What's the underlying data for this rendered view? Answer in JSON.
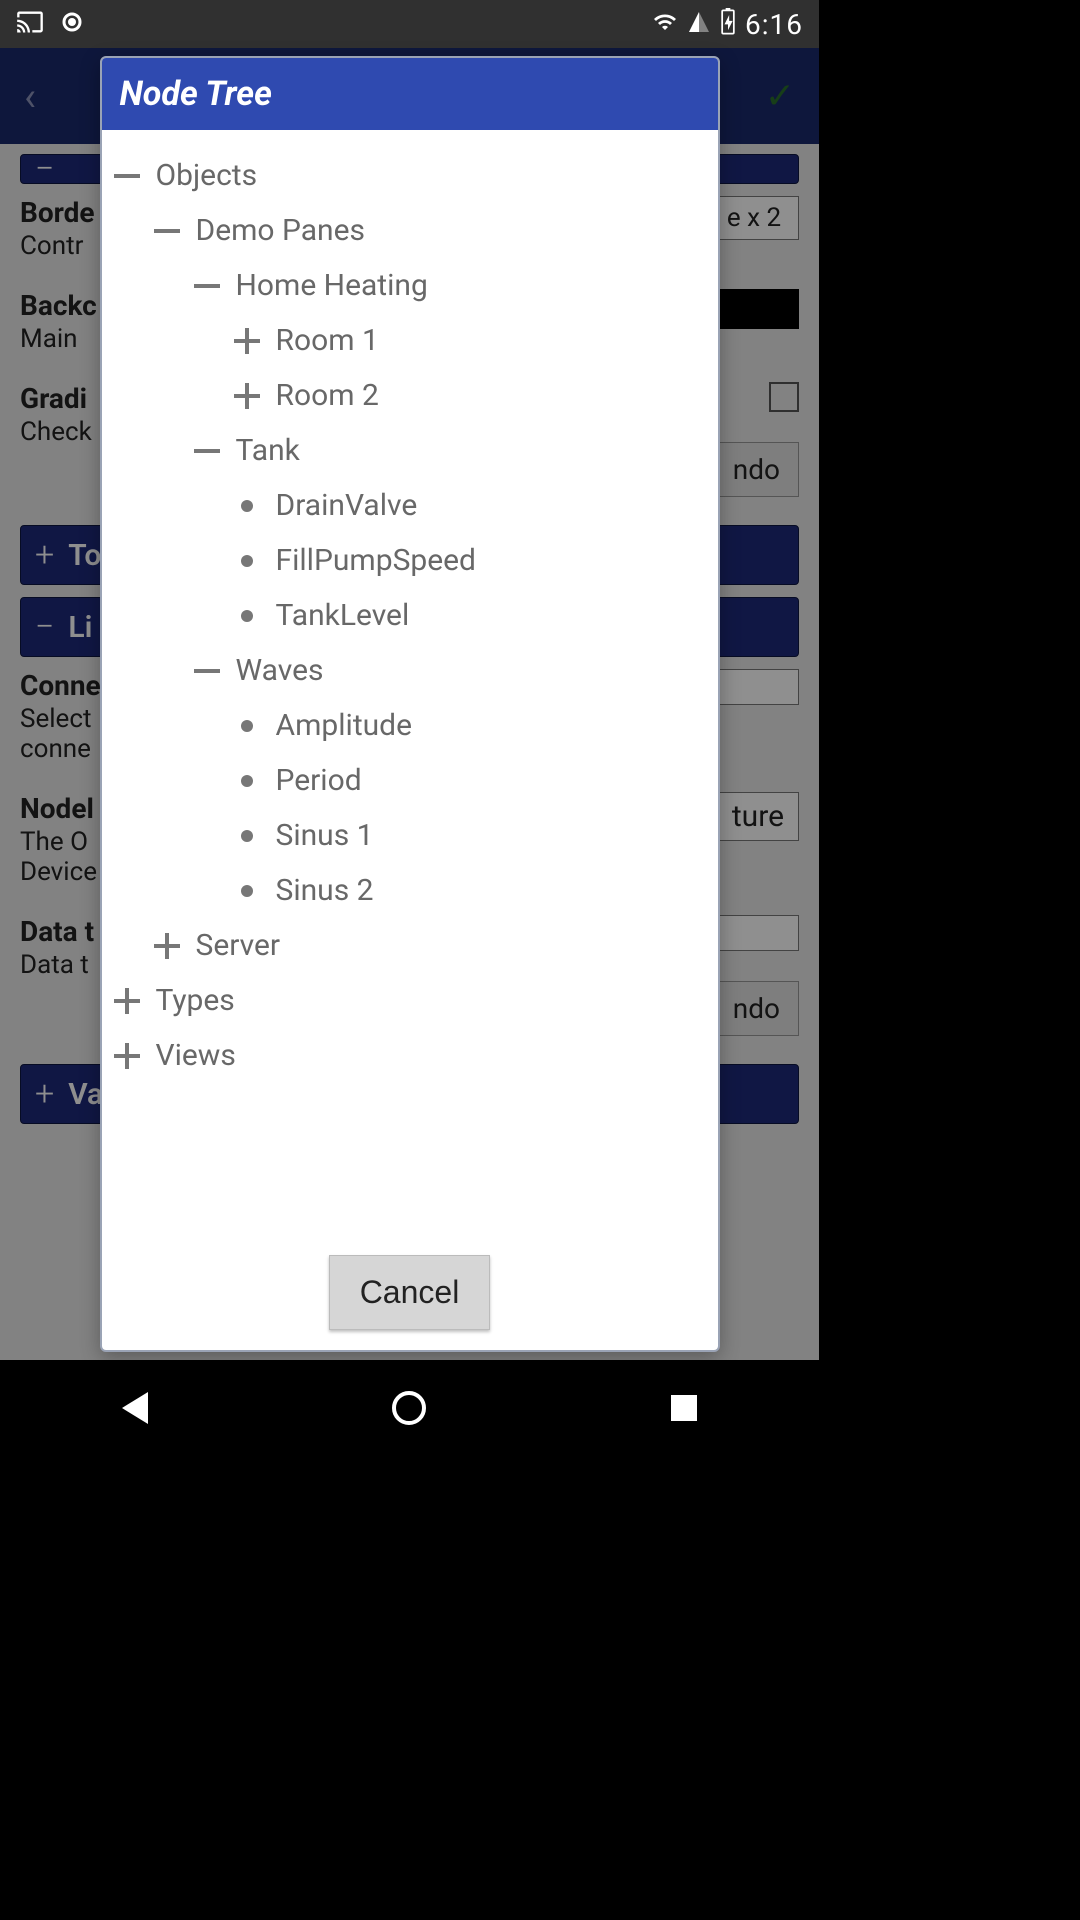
{
  "status": {
    "time": "6:16"
  },
  "bg": {
    "border": {
      "label": "Borde",
      "sub": "Contr"
    },
    "backc": {
      "label": "Backc",
      "sub": "Main"
    },
    "gradi": {
      "label": "Gradi",
      "sub": "Check"
    },
    "bar_to": {
      "label": "To",
      "icon": "+"
    },
    "bar_li": {
      "label": "Li",
      "icon": "−"
    },
    "conn": {
      "label": "Conne",
      "sub": "Select\nconne"
    },
    "nodel": {
      "label": "Nodel",
      "sub": "The O\nDevice"
    },
    "datat": {
      "label": "Data t",
      "sub": "Data t"
    },
    "bar_va": {
      "label": "Va",
      "icon": "+"
    },
    "valbox1": "e x 2",
    "valbox2": "ture",
    "undo": "ndo"
  },
  "modal": {
    "title": "Node Tree",
    "cancel": "Cancel",
    "tree": {
      "objects": {
        "label": "Objects",
        "expanded": true,
        "demo_panes": {
          "label": "Demo Panes",
          "expanded": true,
          "home_heating": {
            "label": "Home Heating",
            "expanded": true,
            "room1": "Room 1",
            "room2": "Room 2"
          },
          "tank": {
            "label": "Tank",
            "expanded": true,
            "drainvalve": "DrainValve",
            "fillpump": "FillPumpSpeed",
            "tanklevel": "TankLevel"
          },
          "waves": {
            "label": "Waves",
            "expanded": true,
            "amplitude": "Amplitude",
            "period": "Period",
            "sinus1": "Sinus 1",
            "sinus2": "Sinus 2"
          }
        },
        "server": "Server"
      },
      "types": "Types",
      "views": "Views"
    }
  }
}
